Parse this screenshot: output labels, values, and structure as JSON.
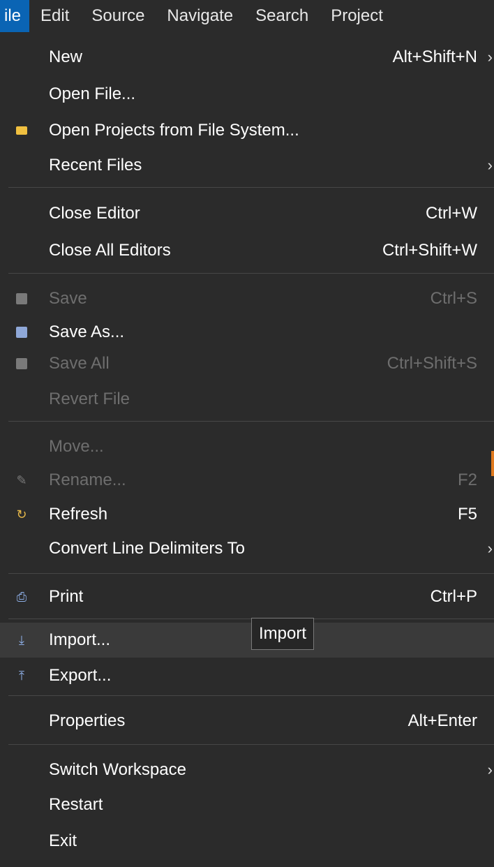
{
  "menubar": {
    "items": [
      {
        "label": "ile",
        "active": true
      },
      {
        "label": "Edit"
      },
      {
        "label": "Source"
      },
      {
        "label": "Navigate"
      },
      {
        "label": "Search"
      },
      {
        "label": "Project"
      }
    ]
  },
  "tooltip": {
    "text": "Import"
  },
  "menu": {
    "new": {
      "label": "New",
      "shortcut": "Alt+Shift+N",
      "arrow": "›"
    },
    "open_file": {
      "label": "Open File..."
    },
    "open_projects": {
      "label": "Open Projects from File System...",
      "icon": "folder-icon"
    },
    "recent_files": {
      "label": "Recent Files",
      "arrow": "›"
    },
    "close_editor": {
      "label": "Close Editor",
      "shortcut": "Ctrl+W"
    },
    "close_all": {
      "label": "Close All Editors",
      "shortcut": "Ctrl+Shift+W"
    },
    "save": {
      "label": "Save",
      "shortcut": "Ctrl+S",
      "icon": "save-icon"
    },
    "save_as": {
      "label": "Save As...",
      "icon": "save-as-icon"
    },
    "save_all": {
      "label": "Save All",
      "shortcut": "Ctrl+Shift+S",
      "icon": "save-all-icon"
    },
    "revert": {
      "label": "Revert File"
    },
    "move": {
      "label": "Move..."
    },
    "rename": {
      "label": "Rename...",
      "shortcut": "F2",
      "icon": "rename-icon"
    },
    "refresh": {
      "label": "Refresh",
      "shortcut": "F5",
      "icon": "refresh-icon"
    },
    "convert": {
      "label": "Convert Line Delimiters To",
      "arrow": "›"
    },
    "print": {
      "label": "Print",
      "shortcut": "Ctrl+P",
      "icon": "print-icon"
    },
    "import": {
      "label": "Import...",
      "icon": "import-icon"
    },
    "export": {
      "label": "Export...",
      "icon": "export-icon"
    },
    "properties": {
      "label": "Properties",
      "shortcut": "Alt+Enter"
    },
    "switch_workspace": {
      "label": "Switch Workspace",
      "arrow": "›"
    },
    "restart": {
      "label": "Restart"
    },
    "exit": {
      "label": "Exit"
    }
  },
  "colors": {
    "background": "#2b2b2b",
    "active_menu": "#0a64b4",
    "disabled_text": "#6e6e6e",
    "hover_row": "#3a3a3a",
    "accent_orange": "#e07a1f"
  }
}
